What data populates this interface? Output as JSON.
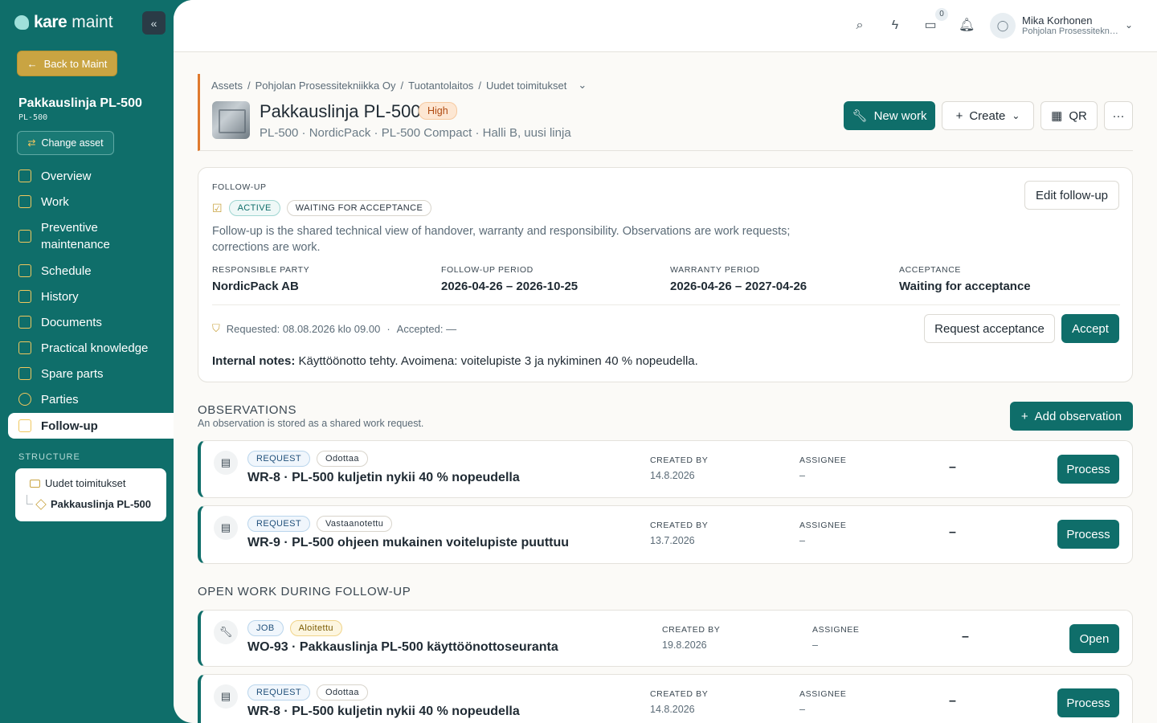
{
  "colors": {
    "brand": "#0f6e6a",
    "accent": "#c9a442",
    "priority_high": "#fde7d3"
  },
  "sidebar": {
    "logo_bold": "kare",
    "logo_light": "maint",
    "back_label": "Back to Maint",
    "asset_title": "Pakkauslinja PL-500",
    "asset_code": "PL-500",
    "change_asset_label": "Change asset",
    "nav": [
      {
        "label": "Overview",
        "icon": "grid-icon"
      },
      {
        "label": "Work",
        "icon": "cube-icon"
      },
      {
        "label": "Preventive maintenance",
        "icon": "cube-icon"
      },
      {
        "label": "Schedule",
        "icon": "calendar-icon"
      },
      {
        "label": "History",
        "icon": "cube-icon"
      },
      {
        "label": "Documents",
        "icon": "cube-icon"
      },
      {
        "label": "Practical knowledge",
        "icon": "cube-icon"
      },
      {
        "label": "Spare parts",
        "icon": "cube-icon"
      },
      {
        "label": "Parties",
        "icon": "users-icon"
      },
      {
        "label": "Follow-up",
        "icon": "clipboard-icon"
      }
    ],
    "structure_label": "STRUCTURE",
    "structure_parent": "Uudet toimitukset",
    "structure_child": "Pakkauslinja PL-500"
  },
  "topbar": {
    "chat_badge": "0",
    "user_name": "Mika Korhonen",
    "user_org": "Pohjolan Prosessiteknik..."
  },
  "header": {
    "breadcrumb": [
      "Assets",
      "Pohjolan Prosessitekniikka Oy",
      "Tuotantolaitos",
      "Uudet toimitukset"
    ],
    "title": "Pakkauslinja PL-500",
    "priority": "High",
    "subtitle": "PL-500 · NordicPack · PL-500 Compact · Halli B, uusi linja",
    "new_work": "New work",
    "create": "Create",
    "qr": "QR"
  },
  "followup": {
    "label": "FOLLOW-UP",
    "status_active": "ACTIVE",
    "status_waiting": "WAITING FOR ACCEPTANCE",
    "edit_label": "Edit follow-up",
    "description": "Follow-up is the shared technical view of handover, warranty and responsibility. Observations are work requests; corrections are work.",
    "fields": [
      {
        "label": "RESPONSIBLE PARTY",
        "value": "NordicPack AB"
      },
      {
        "label": "FOLLOW-UP PERIOD",
        "value": "2026-04-26 – 2026-10-25"
      },
      {
        "label": "WARRANTY PERIOD",
        "value": "2026-04-26 – 2027-04-26"
      },
      {
        "label": "ACCEPTANCE",
        "value": "Waiting for acceptance"
      }
    ],
    "requested": "Requested: 08.08.2026 klo 09.00",
    "accepted": "Accepted: —",
    "request_btn": "Request acceptance",
    "accept_btn": "Accept",
    "notes_label": "Internal notes:",
    "notes_text": "Käyttöönotto tehty. Avoimena: voitelupiste 3 ja nykiminen 40 % nopeudella."
  },
  "observations": {
    "title": "OBSERVATIONS",
    "subtitle": "An observation is stored as a shared work request.",
    "add_label": "Add observation",
    "items": [
      {
        "type": "REQUEST",
        "status": "Odottaa",
        "title": "WR-8 · PL-500 kuljetin nykii 40 % nopeudella",
        "created_label": "CREATED BY",
        "created": "14.8.2026",
        "assignee_label": "ASSIGNEE",
        "assignee": "–",
        "dash": "–",
        "action": "Process"
      },
      {
        "type": "REQUEST",
        "status": "Vastaanotettu",
        "title": "WR-9 · PL-500 ohjeen mukainen voitelupiste puuttuu",
        "created_label": "CREATED BY",
        "created": "13.7.2026",
        "assignee_label": "ASSIGNEE",
        "assignee": "–",
        "dash": "–",
        "action": "Process"
      }
    ]
  },
  "open_work": {
    "title": "OPEN WORK DURING FOLLOW-UP",
    "items": [
      {
        "type": "JOB",
        "status": "Aloitettu",
        "title": "WO-93 · Pakkauslinja PL-500 käyttöönottoseuranta",
        "created_label": "CREATED BY",
        "created": "19.8.2026",
        "assignee_label": "ASSIGNEE",
        "assignee": "–",
        "dash": "–",
        "action": "Open"
      },
      {
        "type": "REQUEST",
        "status": "Odottaa",
        "title": "WR-8 · PL-500 kuljetin nykii 40 % nopeudella",
        "created_label": "CREATED BY",
        "created": "14.8.2026",
        "assignee_label": "ASSIGNEE",
        "assignee": "–",
        "dash": "–",
        "action": "Process"
      }
    ]
  }
}
